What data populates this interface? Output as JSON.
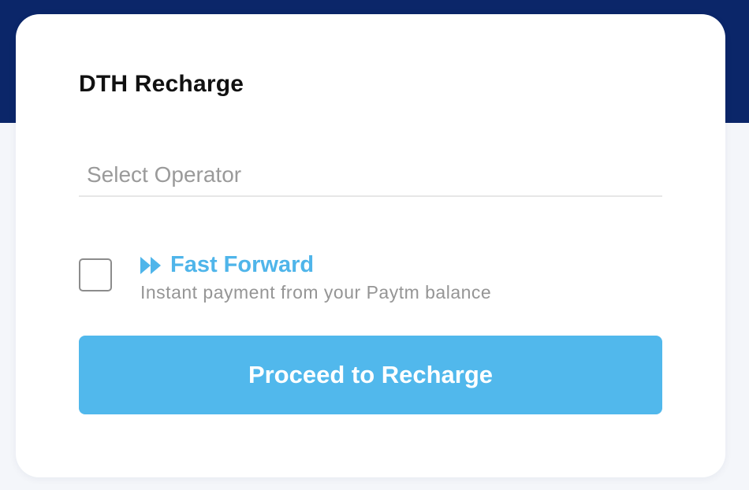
{
  "colors": {
    "header_band": "#0b2669",
    "page_bg": "#f4f6fa",
    "card_bg": "#ffffff",
    "accent": "#4fb5ea",
    "button_bg": "#51b8ec"
  },
  "card": {
    "title": "DTH Recharge"
  },
  "operator_select": {
    "placeholder": "Select Operator",
    "value": ""
  },
  "fast_forward": {
    "checked": false,
    "icon": "fast-forward-icon",
    "title": "Fast Forward",
    "subtitle": "Instant payment from your Paytm balance"
  },
  "proceed_button": {
    "label": "Proceed to Recharge"
  }
}
